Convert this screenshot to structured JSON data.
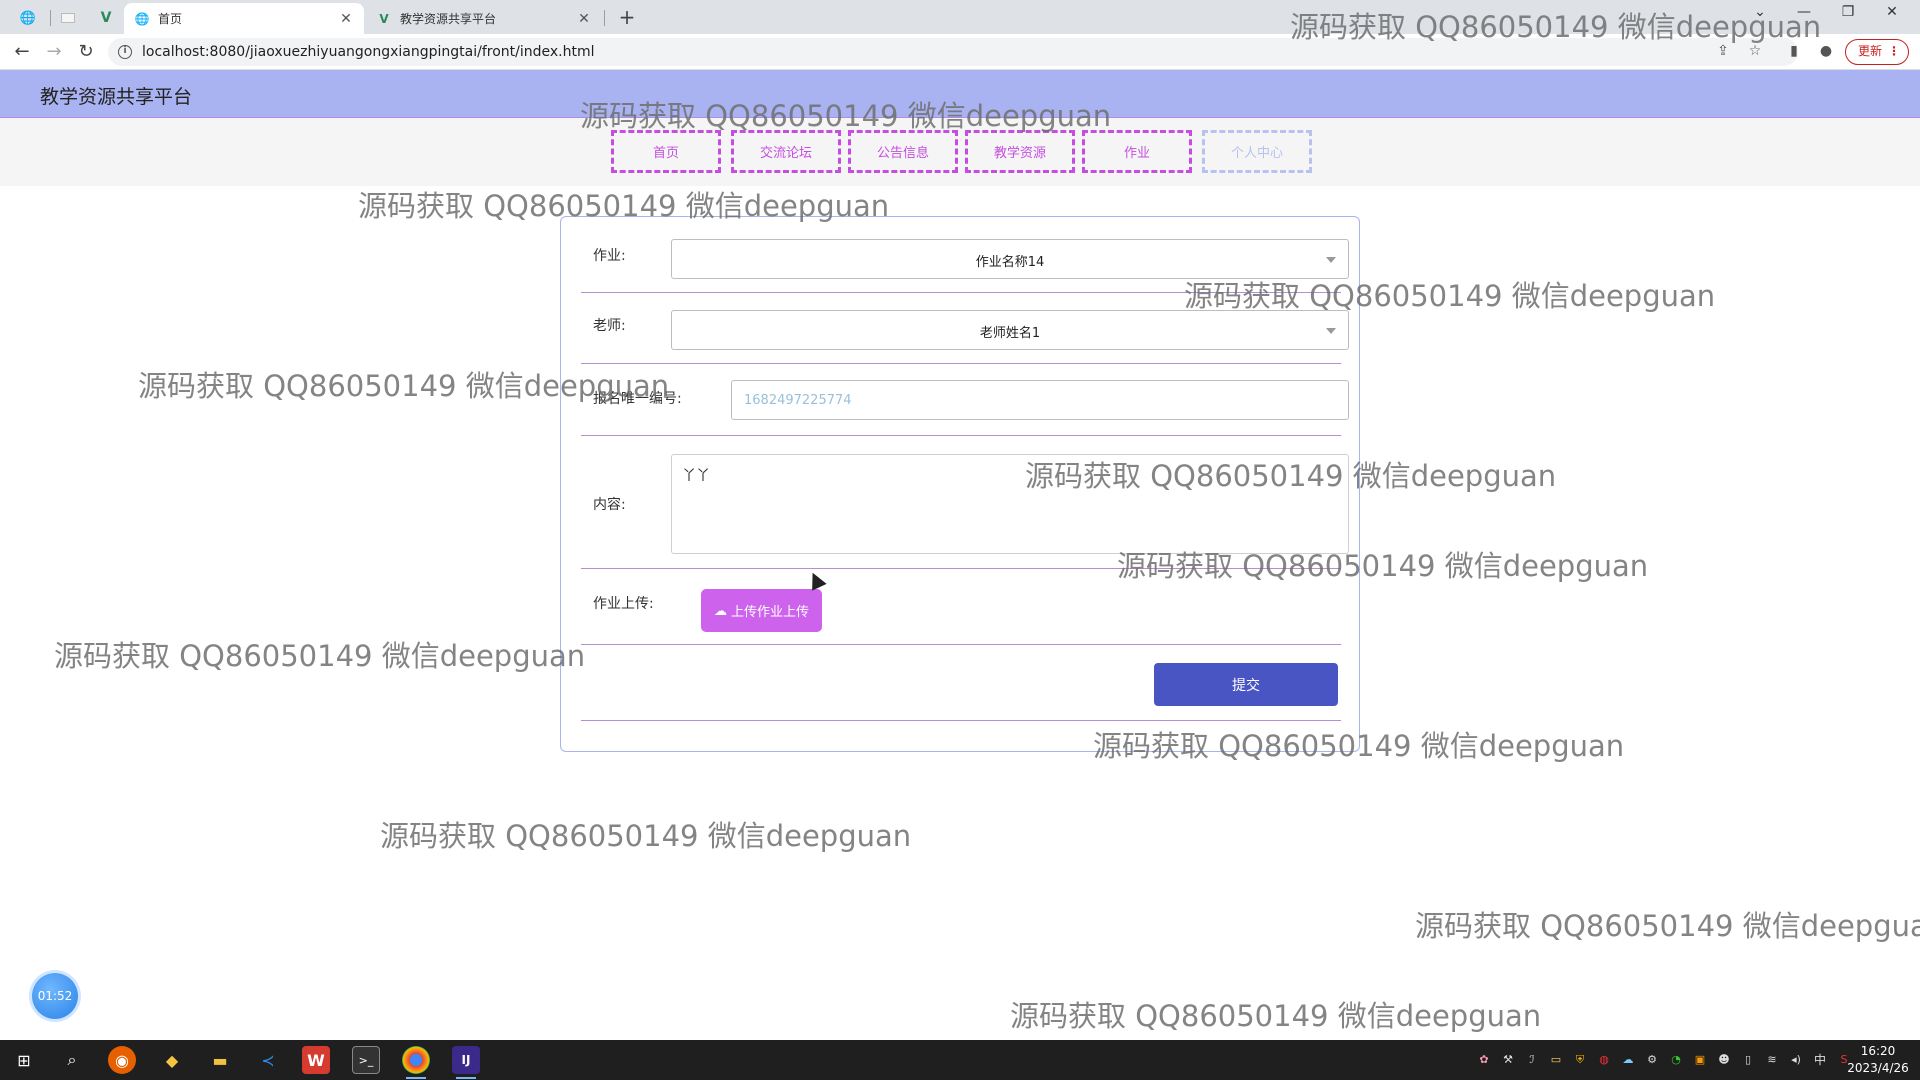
{
  "browser": {
    "tabs": [
      {
        "title": "首页",
        "active": true
      },
      {
        "title": "教学资源共享平台",
        "active": false
      }
    ],
    "url": "localhost:8080/jiaoxuezhiyuangongxiangpingtai/front/index.html",
    "update_label": "更新"
  },
  "site": {
    "title": "教学资源共享平台",
    "nav": [
      {
        "label": "首页"
      },
      {
        "label": "交流论坛"
      },
      {
        "label": "公告信息"
      },
      {
        "label": "教学资源"
      },
      {
        "label": "作业"
      },
      {
        "label": "个人中心"
      }
    ]
  },
  "form": {
    "homework_label": "作业:",
    "homework_value": "作业名称14",
    "teacher_label": "老师:",
    "teacher_value": "老师姓名1",
    "id_label": "报名唯一编号:",
    "id_placeholder": "1682497225774",
    "content_label": "内容:",
    "content_value": "丫丫",
    "upload_label": "作业上传:",
    "upload_button": "上传作业上传",
    "submit_button": "提交"
  },
  "watermark": "源码获取 QQ86050149 微信deepguan",
  "timer": "01:52",
  "taskbar": {
    "time": "16:20",
    "date": "2023/4/26",
    "ime": "中"
  }
}
